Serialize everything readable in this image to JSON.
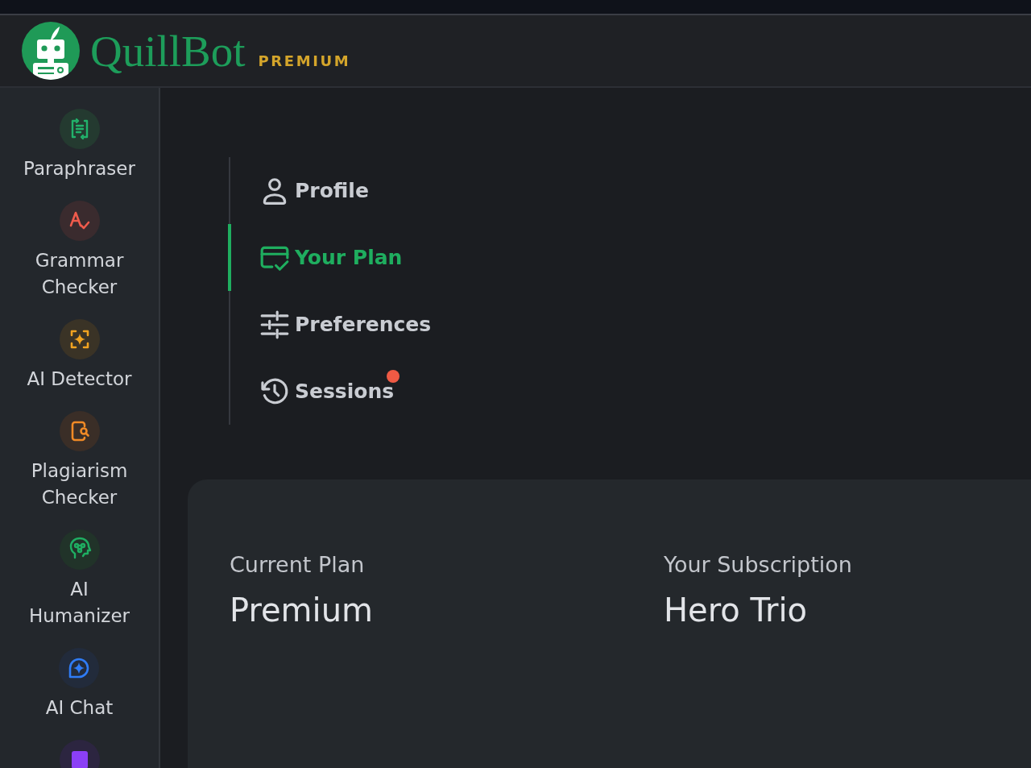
{
  "header": {
    "logo_text": "QuillBot",
    "tier": "PREMIUM"
  },
  "sidebar": {
    "items": [
      {
        "label": "Paraphraser"
      },
      {
        "label": "Grammar Checker"
      },
      {
        "label": "AI Detector"
      },
      {
        "label": "Plagiarism Checker"
      },
      {
        "label": "AI Humanizer"
      },
      {
        "label": "AI Chat"
      }
    ]
  },
  "tabs": [
    {
      "label": "Profile",
      "selected": false,
      "notification": false
    },
    {
      "label": "Your Plan",
      "selected": true,
      "notification": false
    },
    {
      "label": "Preferences",
      "selected": false,
      "notification": false
    },
    {
      "label": "Sessions",
      "selected": false,
      "notification": true
    }
  ],
  "plan_card": {
    "fields": [
      {
        "label": "Current Plan",
        "value": "Premium"
      },
      {
        "label": "Your Subscription",
        "value": "Hero Trio"
      }
    ]
  }
}
